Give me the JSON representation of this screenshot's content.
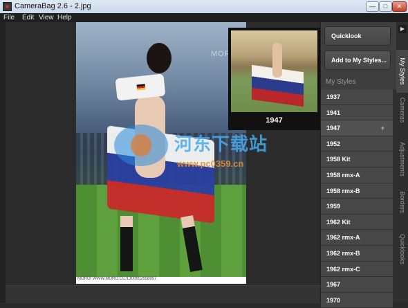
{
  "window": {
    "title": "CameraBag 2.6 - 2.jpg",
    "min_glyph": "—",
    "max_glyph": "□",
    "close_glyph": "✕"
  },
  "menu": [
    "File",
    "Edit",
    "View",
    "Help"
  ],
  "photo": {
    "caption": "MORO! WWW.MORO.CC/1300652658857",
    "brand": "MORO"
  },
  "quicklook_preview": {
    "label": "1947"
  },
  "watermark": {
    "text": "河东下载站",
    "url": "www.pc0359.cn"
  },
  "panel": {
    "quicklook_button": "Quicklook",
    "add_button": "Add to My Styles...",
    "heading": "My Styles",
    "add_glyph": "+",
    "styles": [
      "1937",
      "1941",
      "1947",
      "1952",
      "1958 Kit",
      "1958 rmx-A",
      "1958 rmx-B",
      "1959",
      "1962 Kit",
      "1962 rmx-A",
      "1962 rmx-B",
      "1962 rmx-C",
      "1967",
      "1970"
    ],
    "selected_style": "1947"
  },
  "side_tabs": {
    "arrow": "▶",
    "tabs": [
      "My Styles",
      "Cameras",
      "Adjustments",
      "Borders",
      "Quicklooks"
    ],
    "active": "My Styles"
  }
}
